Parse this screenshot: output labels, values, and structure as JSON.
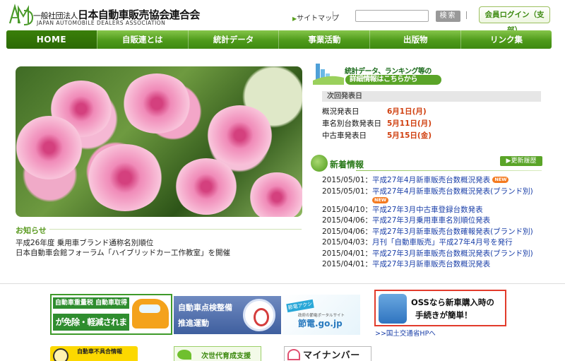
{
  "header": {
    "org_name_prefix": "一般社団法人",
    "org_name": "日本自動車販売協会連合会",
    "org_name_en": "JAPAN AUTOMOBILE DEALERS ASSOCIATION",
    "sitemap_label": "サイトマップ",
    "search_value": "",
    "search_button": "検索",
    "login_button": "会員ログイン（支部）"
  },
  "nav": {
    "items": [
      {
        "label": "HOME"
      },
      {
        "label": "自販連とは"
      },
      {
        "label": "統計データ"
      },
      {
        "label": "事業活動"
      },
      {
        "label": "出版物"
      },
      {
        "label": "リンク集"
      }
    ]
  },
  "stats": {
    "banner_line1": "統計データ、ランキング等の",
    "banner_line2": "詳細情報はこちらから",
    "next_release_title": "次回発表日",
    "rows": [
      {
        "label": "概況発表日",
        "date": "6月1日(月)"
      },
      {
        "label": "車名別台数発表日",
        "date": "5月11日(月)"
      },
      {
        "label": "中古車発表日",
        "date": "5月15日(金)"
      }
    ]
  },
  "news": {
    "title": "新着情報",
    "history_button": "更新履歴",
    "new_badge": "NEW",
    "items": [
      {
        "date": "2015/05/01：",
        "title": "平成27年4月新車販売台数概況発表",
        "new": true
      },
      {
        "date": "2015/05/01：",
        "title": "平成27年4月新車販売台数概況発表(ブランド別)",
        "new": true
      },
      {
        "date": "2015/04/10：",
        "title": "平成27年3月中古車登録台数発表",
        "new": false
      },
      {
        "date": "2015/04/06：",
        "title": "平成27年3月乗用車車名別順位発表",
        "new": false
      },
      {
        "date": "2015/04/06：",
        "title": "平成27年3月新車販売台数確報発表(ブランド別)",
        "new": false
      },
      {
        "date": "2015/04/03：",
        "title": "月刊「自動車販売」平成27年4月号を発行",
        "new": false
      },
      {
        "date": "2015/04/01：",
        "title": "平成27年3月新車販売台数概況発表(ブランド別)",
        "new": false
      },
      {
        "date": "2015/04/01：",
        "title": "平成27年3月新車販売台数概況発表",
        "new": false
      }
    ]
  },
  "notice": {
    "title": "お知らせ",
    "items": [
      "平成26年度 乗用車ブランド通称名別順位",
      "日本自動車会館フォーラム「ハイブリッドカー工作教室」を開催"
    ]
  },
  "banners": {
    "tax_line1": "自動車重量税 自動車取得税",
    "tax_line2": "が免除・軽減されます。",
    "inspection_line1": "自動車点検整備",
    "inspection_line2": "推進運動",
    "setsuden_tag": "節電アクション",
    "setsuden_sub": "政府の節電ポータルサイト",
    "setsuden_domain": "節電.go.jp",
    "oss_line1": "OSSなら新車購入時の",
    "oss_line2": "手続きが簡単！",
    "mlit_link": ">>国土交通省HPへ",
    "defect_label": "自動車不具合情報",
    "nextgen_label": "次世代育成支援",
    "mynumber_label": "マイナンバー"
  }
}
